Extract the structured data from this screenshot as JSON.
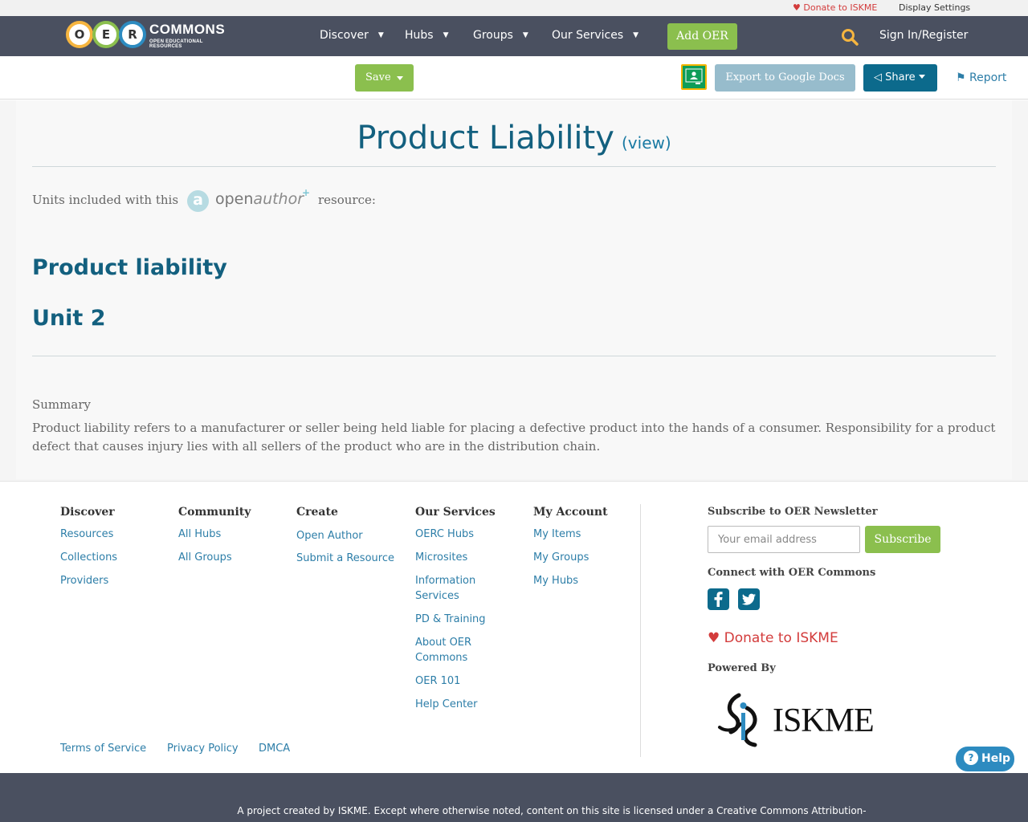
{
  "utility": {
    "donate": "Donate to ISKME",
    "display_settings": "Display Settings"
  },
  "brand": {
    "letters": [
      "O",
      "E",
      "R"
    ],
    "name": "COMMONS",
    "tagline": "OPEN EDUCATIONAL RESOURCES",
    "circle_colors": [
      "#f6b53f",
      "#8bbf4e",
      "#2d8bc0"
    ]
  },
  "nav": {
    "items": [
      {
        "label": "Discover"
      },
      {
        "label": "Hubs"
      },
      {
        "label": "Groups"
      },
      {
        "label": "Our Services"
      }
    ],
    "add_oer": "Add OER",
    "sign_in": "Sign In/Register"
  },
  "toolbar": {
    "save": "Save",
    "export": "Export to Google Docs",
    "share": "Share",
    "report": "Report"
  },
  "resource": {
    "title": "Product Liability",
    "view_link": "(view)",
    "units_intro": "Units included with this",
    "units_suffix": "resource:",
    "openauthor_open": "open",
    "openauthor_author": "author",
    "unit_title": "Product liability",
    "unit_number": "Unit 2",
    "summary_label": "Summary",
    "summary_text": "Product liability refers to a manufacturer or seller being held liable for placing a defective product into the hands of a consumer. Responsibility for a product defect that causes injury lies with all sellers of the product who are in the distribution chain."
  },
  "footer": {
    "columns": [
      {
        "heading": "Discover",
        "links": [
          "Resources",
          "Collections",
          "Providers"
        ]
      },
      {
        "heading": "Community",
        "links": [
          "All Hubs",
          "All Groups"
        ]
      },
      {
        "heading": "Create",
        "links": [
          "Open Author",
          "Submit a Resource"
        ]
      },
      {
        "heading": "Our Services",
        "links": [
          "OERC Hubs",
          "Microsites",
          "Information Services",
          "PD & Training",
          "About OER Commons",
          "OER 101",
          "Help Center"
        ]
      },
      {
        "heading": "My Account",
        "links": [
          "My Items",
          "My Groups",
          "My Hubs"
        ]
      }
    ],
    "newsletter_heading": "Subscribe to OER Newsletter",
    "email_placeholder": "Your email address",
    "subscribe": "Subscribe",
    "connect_heading": "Connect with OER Commons",
    "donate": "Donate to ISKME",
    "powered_by": "Powered By",
    "iskme": "ISKME",
    "legal": [
      "Terms of Service",
      "Privacy Policy",
      "DMCA"
    ],
    "help": "Help",
    "copyright": "A project created by ISKME. Except where otherwise noted, content on this site is licensed under a Creative Commons Attribution-"
  }
}
